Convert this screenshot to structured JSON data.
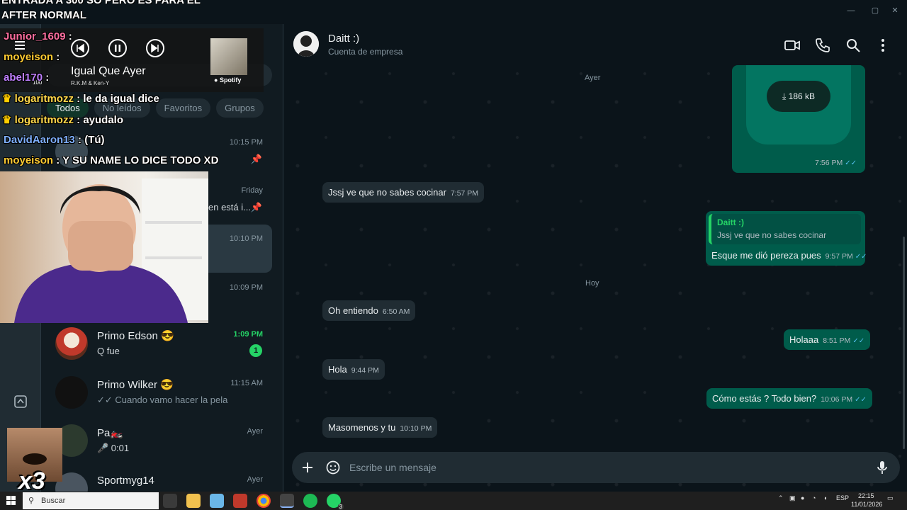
{
  "window": {
    "minimize": "—",
    "maximize": "▢",
    "close": "✕"
  },
  "stream_banner": {
    "line1": "ENTRADA A 300 SO PERO ES PARA EL",
    "line2": "AFTER NORMAL"
  },
  "music_player": {
    "title": "Igual Que Ayer",
    "artist": "R.K.M & Ken-Y",
    "service": "Spotify",
    "volume": "100"
  },
  "stream_chat": [
    {
      "user": "Junior_1609",
      "user_color": "#ff6fa0",
      "message": ""
    },
    {
      "user": "moyeison",
      "user_color": "#ffcc33",
      "message": ""
    },
    {
      "user": "abel170",
      "user_color": "#c080ff",
      "message": ""
    },
    {
      "user": "logaritmozz",
      "user_color": "#ffd84a",
      "message": "le da igual dice"
    },
    {
      "user": "logaritmozz",
      "user_color": "#ffd84a",
      "message": "ayudalo"
    },
    {
      "user": "DavidAaron13",
      "user_color": "#7fb0ff",
      "message": "(Tú)"
    },
    {
      "user": "moyeison",
      "user_color": "#ffcc33",
      "message": "Y SU NAME LO DICE TODO XD"
    }
  ],
  "filters": [
    "Todos",
    "No leídos",
    "Favoritos",
    "Grupos"
  ],
  "chats": [
    {
      "name": "",
      "time": "10:15 PM",
      "preview": "",
      "pinned": true
    },
    {
      "name": "",
      "time": "Friday",
      "preview": "en está i...",
      "pinned": true
    },
    {
      "name": "",
      "time": "10:10 PM",
      "preview": "",
      "selected": true
    },
    {
      "name": "",
      "time": "10:09 PM",
      "preview": ""
    },
    {
      "name": "Primo Edson 😎",
      "time": "1:09 PM",
      "preview": "Q fue",
      "unread": "1"
    },
    {
      "name": "Primo Wilker 😎",
      "time": "11:15 AM",
      "preview": "✓✓ Cuando vamo hacer la pela"
    },
    {
      "name": "Pa🏍️",
      "time": "Ayer",
      "preview": "🎤 0:01"
    },
    {
      "name": "Sportmyg14",
      "time": "Ayer",
      "preview": ""
    }
  ],
  "contact": {
    "name": "Daitt :)",
    "subtitle": "Cuenta de empresa"
  },
  "days": {
    "yesterday": "Ayer",
    "today": "Hoy"
  },
  "document": {
    "size": "186 kB",
    "time": "7:56 PM"
  },
  "messages": [
    {
      "dir": "in",
      "text": "Jssj ve que no sabes cocinar",
      "time": "7:57 PM"
    },
    {
      "dir": "out",
      "quote_name": "Daitt :)",
      "quote_text": "Jssj ve que no sabes cocinar",
      "text": "Esque me dió pereza pues",
      "time": "9:57 PM"
    },
    {
      "dir": "in",
      "text": "Oh entiendo",
      "time": "6:50 AM"
    },
    {
      "dir": "out",
      "text": "Holaaa",
      "time": "8:51 PM"
    },
    {
      "dir": "in",
      "text": "Hola",
      "time": "9:44 PM"
    },
    {
      "dir": "out",
      "text": "Cómo estás ? Todo bien?",
      "time": "10:06 PM"
    },
    {
      "dir": "in",
      "text": "Masomenos y tu",
      "time": "10:10 PM"
    }
  ],
  "composer": {
    "placeholder": "Escribe un mensaje"
  },
  "overlay_multiplier": "x3",
  "taskbar": {
    "search": "Buscar",
    "lang": "ESP",
    "time": "22:15",
    "date": "11/01/2026",
    "whatsapp_badge": "3"
  },
  "colors": {
    "accent": "#25d366",
    "outgoing": "#005c4b",
    "incoming": "#202c33",
    "read_ticks": "#53bdeb"
  }
}
